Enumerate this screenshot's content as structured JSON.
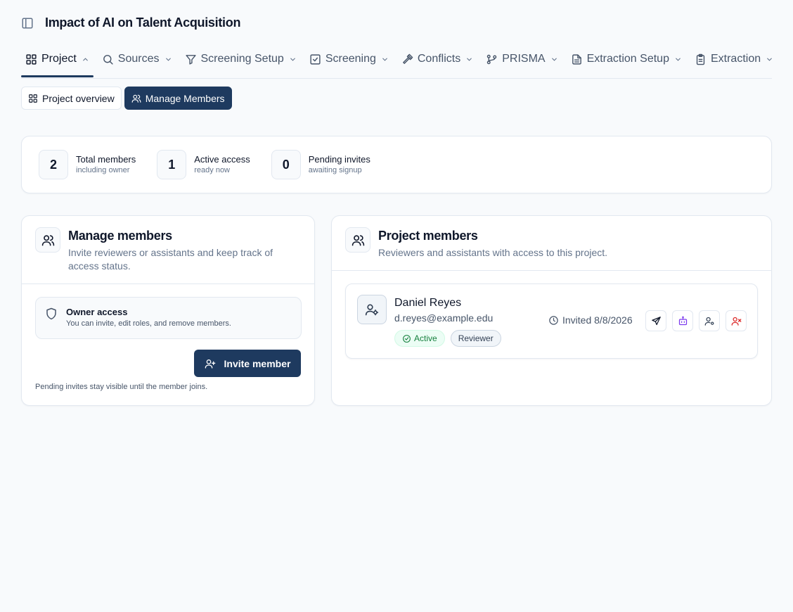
{
  "app": {
    "title": "Impact of AI on Talent Acquisition"
  },
  "nav": {
    "tabs": [
      {
        "label": "Project",
        "icon": "grid-icon",
        "active": true,
        "expanded": true
      },
      {
        "label": "Sources",
        "icon": "search-icon"
      },
      {
        "label": "Screening Setup",
        "icon": "filter-icon"
      },
      {
        "label": "Screening",
        "icon": "checkbox-icon"
      },
      {
        "label": "Conflicts",
        "icon": "gavel-icon"
      },
      {
        "label": "PRISMA",
        "icon": "git-branch-icon"
      },
      {
        "label": "Extraction Setup",
        "icon": "file-text-icon"
      },
      {
        "label": "Extraction",
        "icon": "clipboard-icon"
      }
    ]
  },
  "subtabs": {
    "overview": "Project overview",
    "members": "Manage Members"
  },
  "stats": [
    {
      "value": "2",
      "label": "Total members",
      "sub": "including owner"
    },
    {
      "value": "1",
      "label": "Active access",
      "sub": "ready now"
    },
    {
      "value": "0",
      "label": "Pending invites",
      "sub": "awaiting signup"
    }
  ],
  "manage": {
    "title": "Manage members",
    "subtitle": "Invite reviewers or assistants and keep track of access status.",
    "owner_title": "Owner access",
    "owner_sub": "You can invite, edit roles, and remove members.",
    "invite_label": "Invite member",
    "footnote": "Pending invites stay visible until the member joins."
  },
  "members_panel": {
    "title": "Project members",
    "subtitle": "Reviewers and assistants with access to this project.",
    "members": [
      {
        "name": "Daniel Reyes",
        "email": "d.reyes@example.edu",
        "status": "Active",
        "role": "Reviewer",
        "invited": "Invited 8/8/2026"
      }
    ]
  },
  "colors": {
    "accent": "#1e3a5f",
    "active_green": "#15803d",
    "danger": "#dc2626",
    "assistant_purple": "#7c3aed"
  }
}
